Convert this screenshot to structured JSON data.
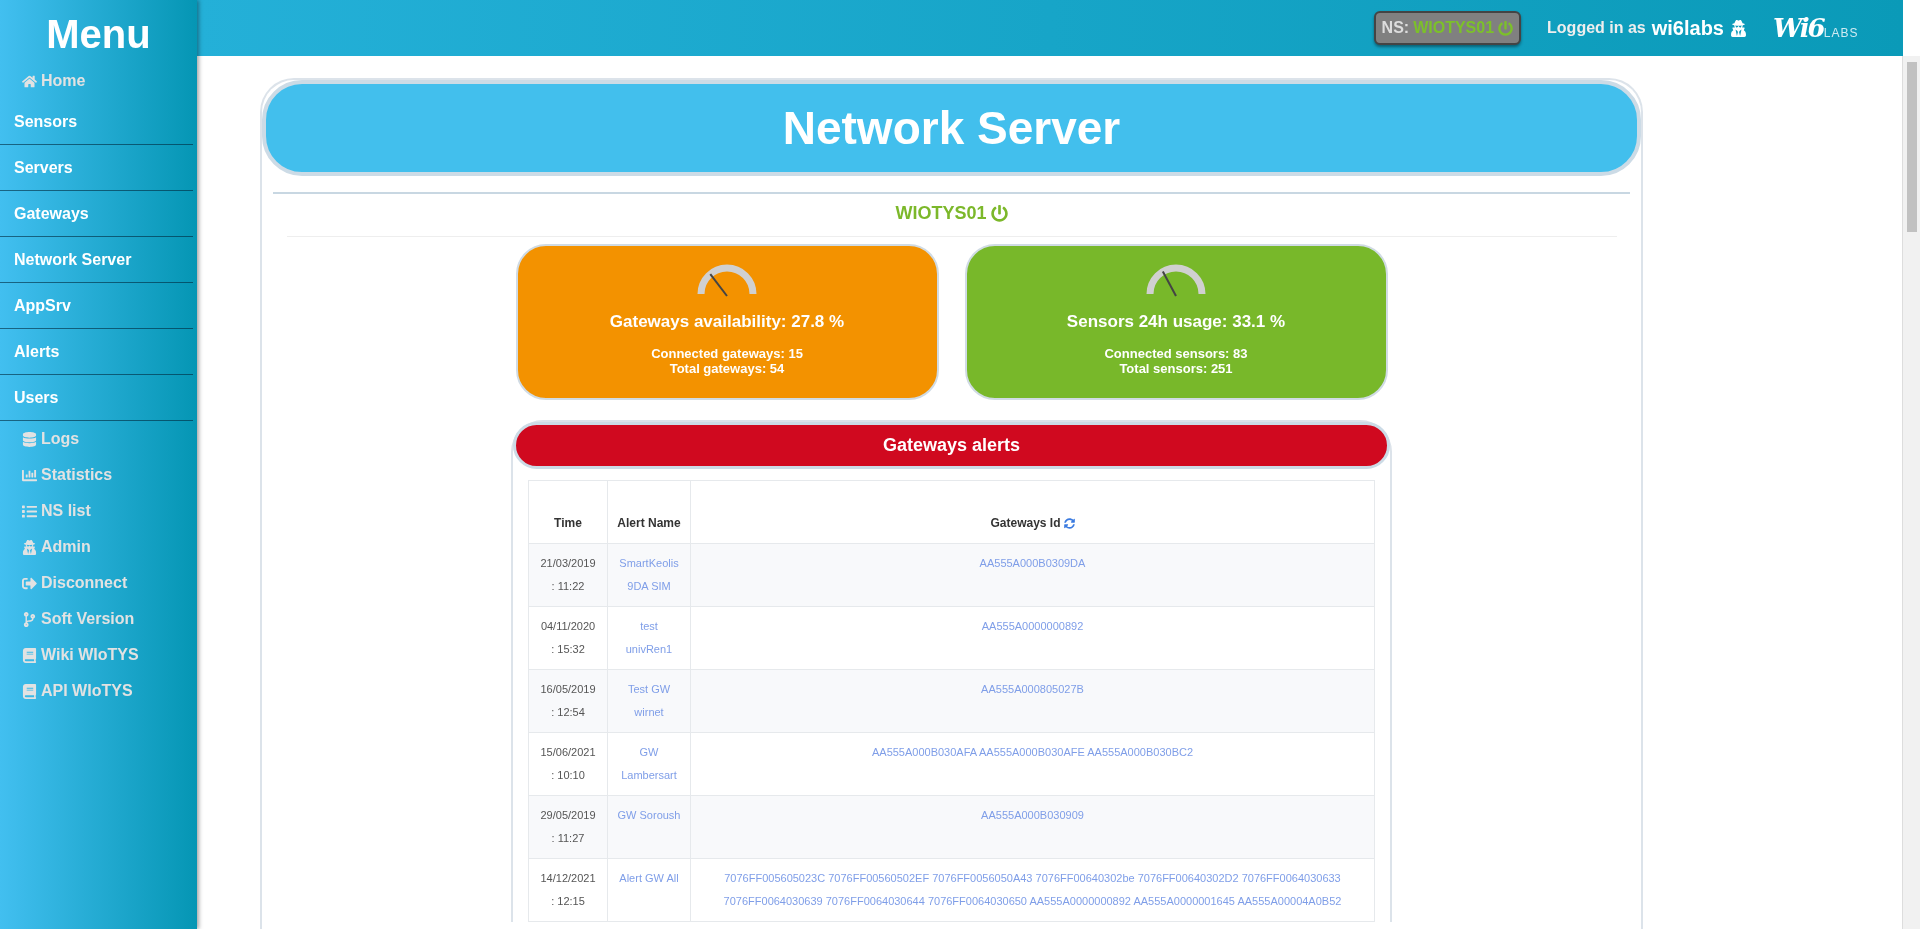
{
  "sidebar": {
    "title": "Menu",
    "items": [
      {
        "label": "Home",
        "kind": "tool"
      },
      {
        "label": "Sensors",
        "kind": "section"
      },
      {
        "label": "Servers",
        "kind": "section"
      },
      {
        "label": "Gateways",
        "kind": "section"
      },
      {
        "label": "Network Server",
        "kind": "section"
      },
      {
        "label": "AppSrv",
        "kind": "section"
      },
      {
        "label": "Alerts",
        "kind": "section"
      },
      {
        "label": "Users",
        "kind": "section"
      },
      {
        "label": "Logs",
        "kind": "tool"
      },
      {
        "label": "Statistics",
        "kind": "tool"
      },
      {
        "label": "NS list",
        "kind": "tool"
      },
      {
        "label": "Admin",
        "kind": "tool"
      },
      {
        "label": "Disconnect",
        "kind": "tool"
      },
      {
        "label": "Soft Version",
        "kind": "tool"
      },
      {
        "label": "Wiki WIoTYS",
        "kind": "tool"
      },
      {
        "label": "API WIoTYS",
        "kind": "tool"
      }
    ]
  },
  "topbar": {
    "ns_label": "NS:",
    "ns_value": "WIOTYS01",
    "login_prefix": "Logged in as",
    "user": "wi6labs",
    "logo": "Wi6",
    "logo_sub": "LABS"
  },
  "page": {
    "title": "Network Server",
    "server": "WIOTYS01"
  },
  "cards": [
    {
      "title": "Gateways availability: 27.8 %",
      "level": 0.278,
      "color": "#f39200",
      "lines": [
        "Connected gateways: 15",
        "Total gateways: 54"
      ]
    },
    {
      "title": "Sensors 24h usage: 33.1 %",
      "level": 0.331,
      "color": "#78b82a",
      "lines": [
        "Connected sensors: 83",
        "Total sensors: 251"
      ]
    }
  ],
  "alerts": {
    "title": "Gateways alerts",
    "columns": [
      "Time",
      "Alert Name",
      "Gateways Id"
    ],
    "rows": [
      {
        "time": "21/03/2019 : 11:22",
        "name": "SmartKeolis 9DA SIM",
        "ids": "AA555A000B0309DA"
      },
      {
        "time": "04/11/2020 : 15:32",
        "name": "test univRen1",
        "ids": "AA555A0000000892"
      },
      {
        "time": "16/05/2019 : 12:54",
        "name": "Test GW wirnet",
        "ids": "AA555A000805027B"
      },
      {
        "time": "15/06/2021 : 10:10",
        "name": "GW Lambersart",
        "ids": "AA555A000B030AFA AA555A000B030AFE AA555A000B030BC2"
      },
      {
        "time": "29/05/2019 : 11:27",
        "name": "GW Soroush",
        "ids": "AA555A000B030909"
      },
      {
        "time": "14/12/2021 : 12:15",
        "name": "Alert GW All",
        "ids": "7076FF005605023C 7076FF00560502EF 7076FF0056050A43 7076FF00640302be 7076FF00640302D2 7076FF0064030633 7076FF0064030639 7076FF0064030644 7076FF0064030650 AA555A0000000892 AA555A0000001645 AA555A00004A0B52"
      }
    ]
  }
}
